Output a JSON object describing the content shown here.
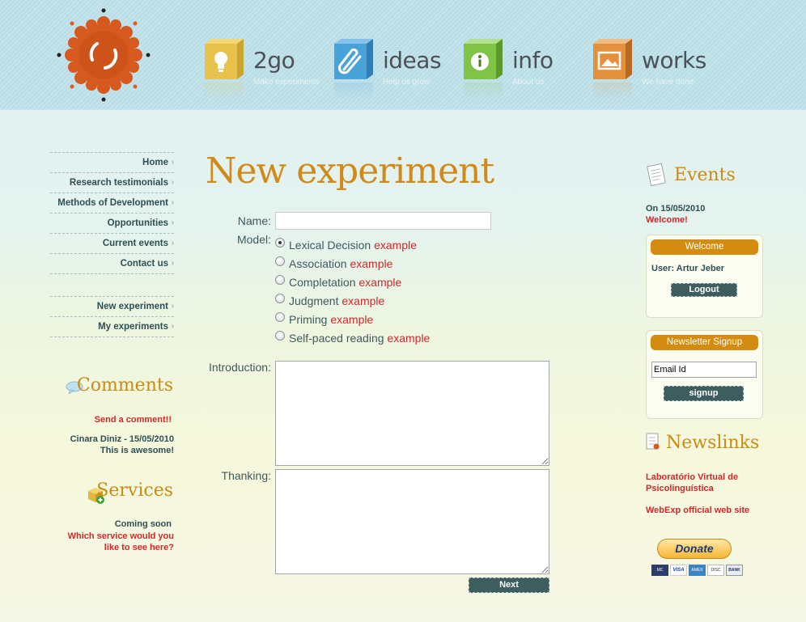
{
  "nav": [
    {
      "title": "2go",
      "sub": "Make experiments",
      "color": "#e7c24a",
      "icon": "bulb-icon"
    },
    {
      "title": "ideas",
      "sub": "Help us grow",
      "color": "#4aa3d8",
      "icon": "paperclip-icon"
    },
    {
      "title": "info",
      "sub": "About us",
      "color": "#7fc347",
      "icon": "info-icon"
    },
    {
      "title": "works",
      "sub": "We have done",
      "color": "#e4913d",
      "icon": "picture-icon"
    }
  ],
  "leftmenu": {
    "items": [
      "Home",
      "Research testimonials",
      "Methods of Development",
      "Opportunities",
      "Current events",
      "Contact us"
    ],
    "items2": [
      "New experiment",
      "My experiments"
    ]
  },
  "comments": {
    "heading": "Comments",
    "send": "Send a comment!!",
    "author": "Cinara Diniz - 15/05/2010",
    "text": "This is awesome!"
  },
  "services": {
    "heading": "Services",
    "soon": "Coming soon",
    "question": "Which service would you like to see here?"
  },
  "form": {
    "title": "New experiment",
    "name_label": "Name:",
    "name_value": "",
    "model_label": "Model:",
    "models": [
      {
        "label": "Lexical Decision",
        "link": "example",
        "checked": true
      },
      {
        "label": "Association",
        "link": "example",
        "checked": false
      },
      {
        "label": "Completation",
        "link": "example",
        "checked": false
      },
      {
        "label": "Judgment",
        "link": "example",
        "checked": false
      },
      {
        "label": "Priming",
        "link": "example",
        "checked": false
      },
      {
        "label": "Self-paced reading",
        "link": "example",
        "checked": false
      }
    ],
    "intro_label": "Introduction:",
    "thanking_label": "Thanking:",
    "next": "Next"
  },
  "events": {
    "heading": "Events",
    "date": "On 15/05/2010",
    "text": "Welcome!"
  },
  "welcome_box": {
    "heading": "Welcome",
    "user": "User: Artur Jeber",
    "logout": "Logout"
  },
  "newsletter": {
    "heading": "Newsletter Signup",
    "input_value": "Email Id",
    "signup": "signup"
  },
  "newslinks": {
    "heading": "Newslinks",
    "links": [
      "Laboratório Virtual de Psicolinguística",
      "WebExp official web site"
    ]
  },
  "donate": {
    "label": "Donate",
    "cards": [
      "MC",
      "VISA",
      "AMEX",
      "DISC",
      "BANK"
    ]
  },
  "colors": {
    "accent": "#cf8a19",
    "link": "#d0282a",
    "button": "#3e5d5e"
  }
}
